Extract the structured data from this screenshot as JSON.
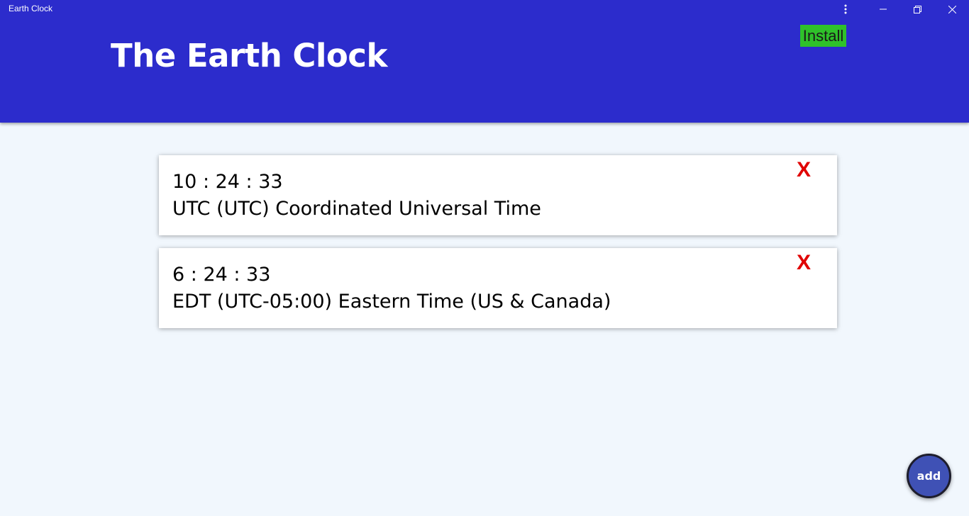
{
  "window": {
    "title": "Earth Clock"
  },
  "header": {
    "title": "The Earth Clock",
    "install_label": "Install",
    "background_color": "#2c2ccc",
    "install_color": "#2fc12a"
  },
  "clocks": [
    {
      "time": "10 : 24 : 33",
      "zone": "UTC (UTC) Coordinated Universal Time",
      "remove_label": "X"
    },
    {
      "time": "6 : 24 : 33",
      "zone": "EDT (UTC-05:00) Eastern Time (US & Canada)",
      "remove_label": "X"
    }
  ],
  "fab": {
    "label": "add",
    "color": "#3f51b5"
  }
}
